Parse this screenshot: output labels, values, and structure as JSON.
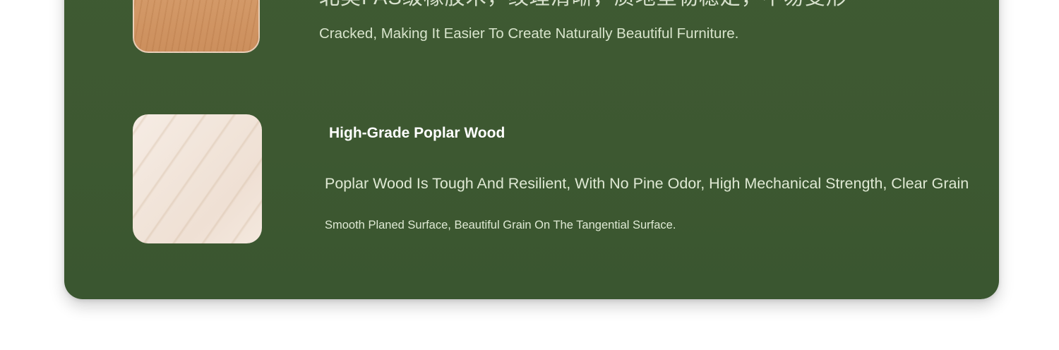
{
  "features": [
    {
      "swatch": "oak-wood-swatch",
      "cn_text": "北美FAS级橡胶木，纹理清晰，质地坚韧稳定，不易变形",
      "description": "Cracked, Making It Easier To Create Naturally Beautiful Furniture."
    },
    {
      "swatch": "poplar-wood-swatch",
      "title": "High-Grade Poplar Wood",
      "description": "Poplar Wood Is Tough And Resilient, With No Pine Odor, High Mechanical Strength, Clear Grain",
      "subtext": "Smooth Planed Surface, Beautiful Grain On The Tangential Surface."
    }
  ],
  "colors": {
    "card_background": "#3d5831",
    "oak": "#d59c6b",
    "poplar": "#f3e7dd",
    "title_text": "#ffffff",
    "body_text": "#dfe9d4"
  }
}
